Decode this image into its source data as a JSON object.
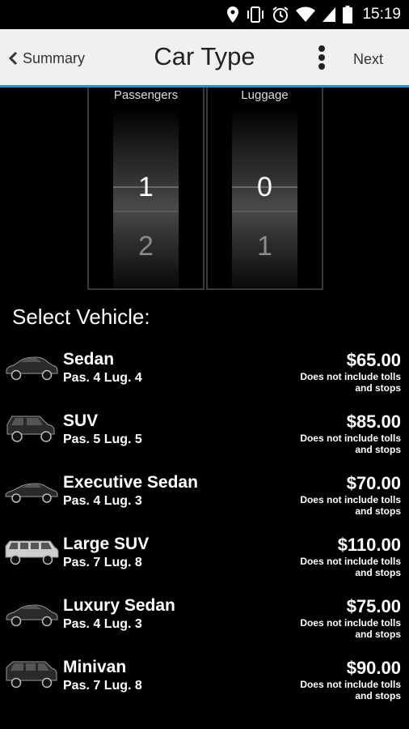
{
  "status_bar": {
    "time": "15:19",
    "icons": [
      "location-pin-icon",
      "vibrate-icon",
      "alarm-icon",
      "wifi-icon",
      "cell-signal-icon",
      "battery-icon"
    ]
  },
  "header": {
    "back_label": "Summary",
    "title": "Car Type",
    "next_label": "Next",
    "accent_color": "#2e8fc0"
  },
  "pickers": [
    {
      "label": "Passengers",
      "selected": "1",
      "next": "2"
    },
    {
      "label": "Luggage",
      "selected": "0",
      "next": "1"
    }
  ],
  "section_title": "Select Vehicle:",
  "vehicles": [
    {
      "name": "Sedan",
      "capacity": "Pas. 4 Lug. 4",
      "price": "$65.00",
      "note": "Does not include tolls and stops",
      "icon": "sedan-car-icon"
    },
    {
      "name": "SUV",
      "capacity": "Pas. 5 Lug. 5",
      "price": "$85.00",
      "note": "Does not include tolls and stops",
      "icon": "suv-car-icon"
    },
    {
      "name": "Executive Sedan",
      "capacity": "Pas. 4 Lug. 3",
      "price": "$70.00",
      "note": "Does not include tolls and stops",
      "icon": "executive-sedan-icon"
    },
    {
      "name": "Large SUV",
      "capacity": "Pas. 7 Lug. 8",
      "price": "$110.00",
      "note": "Does not include tolls and stops",
      "icon": "limousine-icon"
    },
    {
      "name": "Luxury Sedan",
      "capacity": "Pas. 4 Lug. 3",
      "price": "$75.00",
      "note": "Does not include tolls and stops",
      "icon": "luxury-sedan-icon"
    },
    {
      "name": "Minivan",
      "capacity": "Pas. 7 Lug. 8",
      "price": "$90.00",
      "note": "Does not include tolls and stops",
      "icon": "minivan-icon"
    }
  ]
}
